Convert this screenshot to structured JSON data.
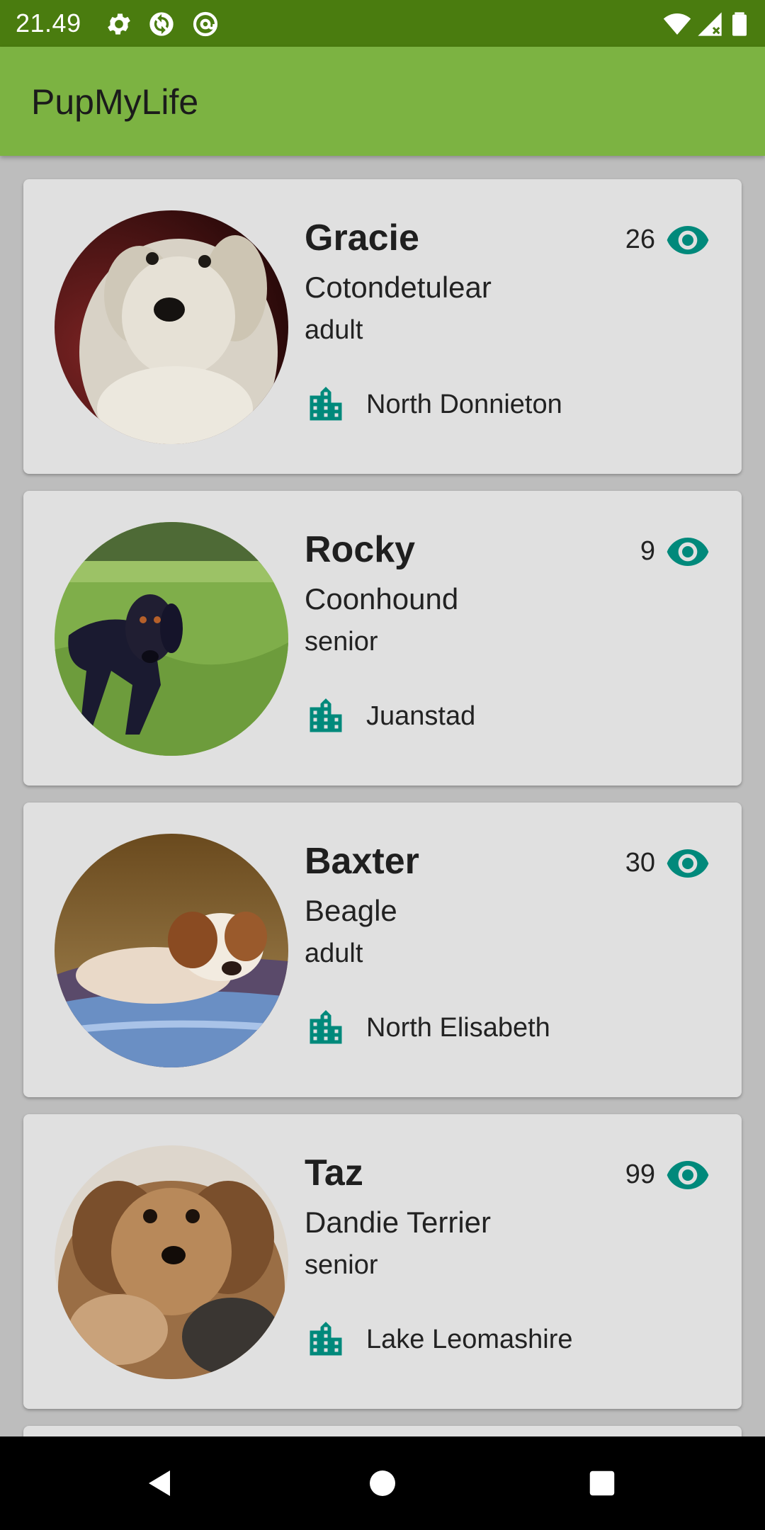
{
  "status_bar": {
    "time": "21.49",
    "icons": [
      "gear-icon",
      "sync-icon",
      "at-sign-icon",
      "wifi-icon",
      "signal-icon",
      "battery-icon"
    ]
  },
  "app_bar": {
    "title": "PupMyLife"
  },
  "colors": {
    "status_bar": "#4a7c0f",
    "app_bar": "#7cb342",
    "accent": "#00897b",
    "card": "#e0e0e0",
    "list_background": "#bdbdbd"
  },
  "dogs": [
    {
      "name": "Gracie",
      "breed": "Cotondetulear",
      "age": "adult",
      "views": "26",
      "location": "North Donnieton"
    },
    {
      "name": "Rocky",
      "breed": "Coonhound",
      "age": "senior",
      "views": "9",
      "location": "Juanstad"
    },
    {
      "name": "Baxter",
      "breed": "Beagle",
      "age": "adult",
      "views": "30",
      "location": "North Elisabeth"
    },
    {
      "name": "Taz",
      "breed": "Dandie Terrier",
      "age": "senior",
      "views": "99",
      "location": "Lake Leomashire"
    }
  ],
  "nav_bar": {
    "buttons": [
      "back-icon",
      "home-icon",
      "recents-icon"
    ]
  }
}
